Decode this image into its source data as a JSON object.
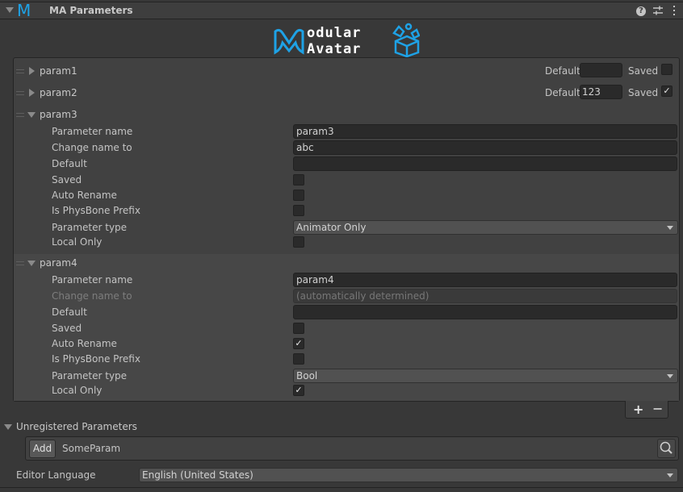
{
  "header": {
    "logo_glyph": "M",
    "title": "MA Parameters",
    "icons": [
      "help-icon",
      "preset-icon",
      "kebab-menu-icon"
    ],
    "help_glyph": "?",
    "preset_glyph": "⇌",
    "menu_glyph": "⋮",
    "accent_color": "#1ea2e6"
  },
  "banner": {
    "line1": "odular",
    "line2": "Avatar"
  },
  "parameters": [
    {
      "name": "param1",
      "expanded": false,
      "default_label": "Default",
      "default_value": "",
      "saved_label": "Saved",
      "saved": false
    },
    {
      "name": "param2",
      "expanded": false,
      "default_label": "Default",
      "default_value": "123",
      "saved_label": "Saved",
      "saved": true
    },
    {
      "name": "param3",
      "expanded": true,
      "fields": {
        "parameter_name_label": "Parameter name",
        "parameter_name": "param3",
        "change_name_label": "Change name to",
        "change_name": "abc",
        "default_label": "Default",
        "default_value": "",
        "saved_label": "Saved",
        "saved": false,
        "auto_rename_label": "Auto Rename",
        "auto_rename": false,
        "physbone_label": "Is PhysBone Prefix",
        "physbone": false,
        "type_label": "Parameter type",
        "type": "Animator Only",
        "local_only_label": "Local Only",
        "local_only": false
      }
    },
    {
      "name": "param4",
      "expanded": true,
      "selected": true,
      "fields": {
        "parameter_name_label": "Parameter name",
        "parameter_name": "param4",
        "change_name_label": "Change name to",
        "change_name_placeholder": "(automatically determined)",
        "default_label": "Default",
        "default_value": "",
        "saved_label": "Saved",
        "saved": false,
        "auto_rename_label": "Auto Rename",
        "auto_rename": true,
        "physbone_label": "Is PhysBone Prefix",
        "physbone": false,
        "type_label": "Parameter type",
        "type": "Bool",
        "local_only_label": "Local Only",
        "local_only": true
      }
    }
  ],
  "list_footer": {
    "add_label": "+",
    "remove_label": "−"
  },
  "unregistered": {
    "label": "Unregistered Parameters",
    "add_button": "Add",
    "items": [
      "SomeParam"
    ]
  },
  "editor_language": {
    "label": "Editor Language",
    "value": "English (United States)"
  },
  "check_glyph": "✓"
}
